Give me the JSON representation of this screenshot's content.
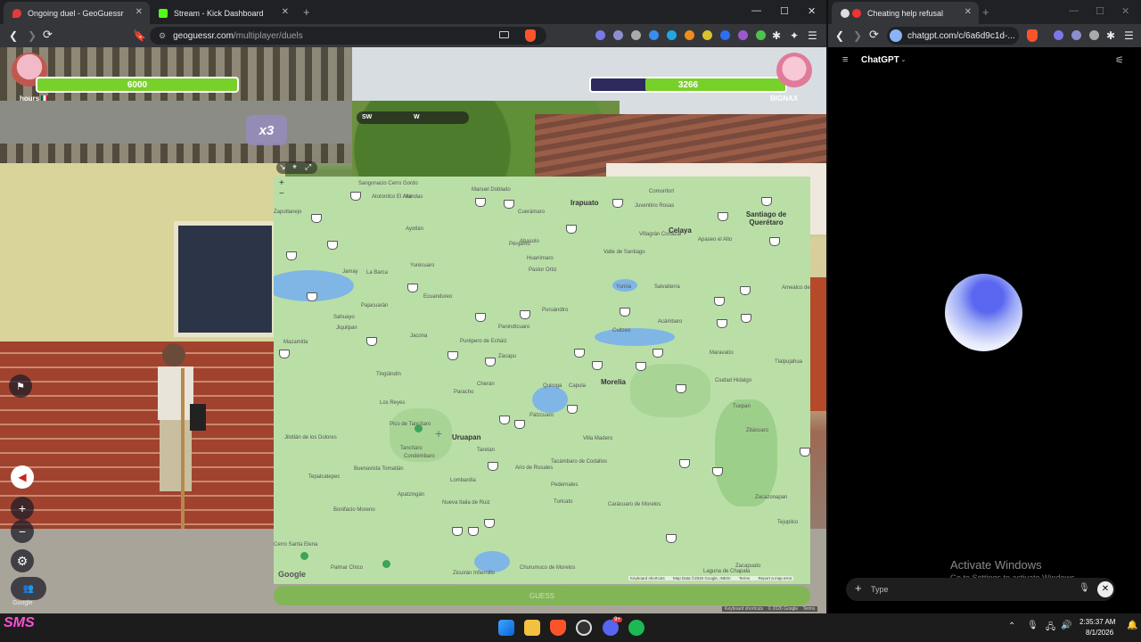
{
  "left_browser": {
    "tabs": [
      {
        "title": "Ongoing duel - GeoGuessr",
        "active": true
      },
      {
        "title": "Stream - Kick Dashboard",
        "active": false
      }
    ],
    "new_tab": "+",
    "url_domain": "geoguessr.com",
    "url_path": "/multiplayer/duels",
    "window_controls": [
      "—",
      "☐",
      "✕"
    ]
  },
  "game": {
    "player1": {
      "name": "hours",
      "hp": "6000"
    },
    "player2": {
      "name": "BIGNAX",
      "hp": "3266"
    },
    "player2_hp_fraction": 0.72,
    "multiplier": "x3",
    "compass": {
      "left": "SW",
      "center": "W"
    },
    "zoom_in": "+",
    "zoom_out": "−",
    "google_label": "Google",
    "guess_button": "GUESS",
    "footer": [
      "Keyboard shortcuts",
      "© 2026 Google",
      "Terms"
    ]
  },
  "map": {
    "zoom_plus": "+",
    "zoom_minus": "−",
    "google_logo": "Google",
    "attribution": [
      "Keyboard shortcuts",
      "Map Data ©2026 Google, INEGI",
      "Terms",
      "Report a map error"
    ],
    "cities_big": [
      "Irapuato",
      "Celaya",
      "Santiago de Querétaro",
      "Morelia",
      "Uruapan"
    ],
    "towns": [
      "Sangonacio Cerro Gordo",
      "Manuel Doblado",
      "Arandas",
      "Zapotlanejo",
      "Atotonilco El Alto",
      "Ayotlán",
      "Cuerámaro",
      "Juventino Rosas",
      "Comonfort",
      "Villagrán Cortazar",
      "Valle de Santiago",
      "Pénjamo",
      "Abasolo",
      "Huanímaro",
      "Pastor Ortiz",
      "Yuriria",
      "Salvatierra",
      "Apaseo el Alto",
      "Jamay",
      "La Barca",
      "Yurécuaro",
      "Ecuandureo",
      "Pajacuarán",
      "Sahuayo",
      "Jiquilpan",
      "Jacona",
      "Purépero de Echáiz",
      "Zacapu",
      "Panindícuaro",
      "Puruándiro",
      "Cuitzeo",
      "Acámbaro",
      "Maravatío",
      "Amealco de Bonfil",
      "Tlalpujahua",
      "Ciudad Hidalgo",
      "Mazamitla",
      "Tingüindín",
      "Cherán",
      "Paracho",
      "Los Reyes",
      "Quiroga",
      "Capula",
      "Pátzcuaro",
      "Tuxpan",
      "Zitácuaro",
      "Villa Madero",
      "Tacámbaro de Codallos",
      "Ario de Rosales",
      "Taretan",
      "Pico de Tancítaro",
      "Tancítaro",
      "Condémbaro",
      "Jilotlán de los Dolores",
      "Buenavista Tomatlán",
      "Tepalcatepec",
      "Apatzingán",
      "Lombardía",
      "Nueva Italia de Ruiz",
      "Pedernales",
      "Turicato",
      "Carácuaro de Morelos",
      "Zacazonapan",
      "Tejupilco",
      "Bonifacio Moreno",
      "Churumuco de Morelos",
      "Zicuirán Infiernillo",
      "Cerro Santa Elena",
      "Palmar Chico",
      "Zacapuato",
      "Laguna de Chapala"
    ]
  },
  "right_browser": {
    "tab_title": "Cheating help refusal",
    "new_tab": "+",
    "url": "chatgpt.com/c/6a6d9c1d-...",
    "window_controls": [
      "—",
      "☐",
      "✕"
    ],
    "app_name": "ChatGPT",
    "input_placeholder": "Type",
    "watermark_title": "Activate Windows",
    "watermark_sub": "Go to Settings to activate Windows."
  },
  "taskbar": {
    "time": "2:35:37 AM",
    "date": "8/1/2026",
    "discord_badge": "9+"
  },
  "colors": {
    "hp_green": "#78d12b",
    "hp_purple": "#2e2a5e",
    "map_green": "#b9dfa7",
    "chrome_dark": "#202124"
  }
}
